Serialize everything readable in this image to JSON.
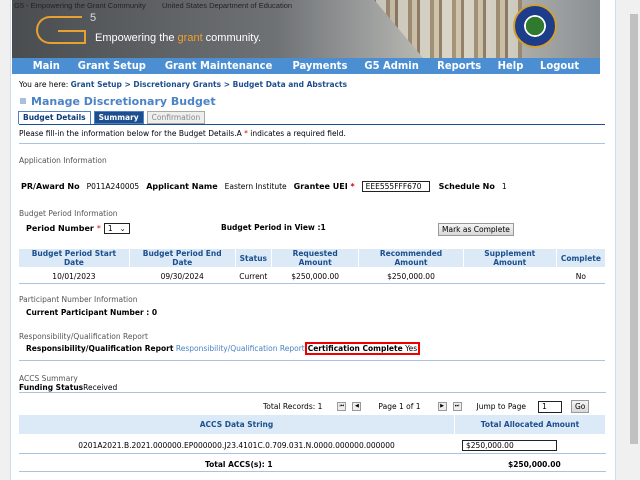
{
  "header": {
    "alt_logo": "G5 - Empowering the Grant Community",
    "alt_dept": "United States Department of Education",
    "tagline_pre": "Empowering the ",
    "tagline_accent": "grant",
    "tagline_post": " community."
  },
  "nav": [
    "Main",
    "Grant Setup",
    "Grant Maintenance",
    "Payments",
    "G5 Admin",
    "Reports",
    "Help",
    "Logout"
  ],
  "breadcrumb": {
    "prefix": "You are here: ",
    "items": [
      "Grant Setup",
      "Discretionary Grants",
      "Budget Data and Abstracts"
    ],
    "sep": " > "
  },
  "page_title": "Manage Discretionary Budget",
  "tabs": [
    "Budget Details",
    "Summary",
    "Confirmation"
  ],
  "instructions": {
    "pre": "Please fill-in the information below for the Budget Details.A ",
    "star": "*",
    "post": " indicates a required field."
  },
  "app_info": {
    "section": "Application Information",
    "award_label": "PR/Award No",
    "award": "P011A240005",
    "applicant_label": "Applicant Name",
    "applicant": "Eastern Institute",
    "uei_label": "Grantee UEI",
    "uei": "EEE555FFF670",
    "schedule_label": "Schedule No",
    "schedule": "1"
  },
  "budget_period": {
    "section": "Budget Period Information",
    "period_label": "Period Number",
    "period_value": "1",
    "in_view": "Budget Period in View :1",
    "mark_complete": "Mark as Complete",
    "columns": [
      "Budget Period Start Date",
      "Budget Period End Date",
      "Status",
      "Requested Amount",
      "Recommended Amount",
      "Supplement Amount",
      "Complete"
    ],
    "rows": [
      [
        "10/01/2023",
        "09/30/2024",
        "Current",
        "$250,000.00",
        "$250,000.00",
        "",
        "No"
      ]
    ]
  },
  "participant": {
    "section": "Participant Number Information",
    "label": "Current Participant Number : 0"
  },
  "responsibility": {
    "section": "Responsibility/Qualification Report",
    "label": "Responsibility/Qualification Report",
    "link": "Responsibility/Qualification Report",
    "cert_label": "Certification Complete",
    "cert_value": "Yes"
  },
  "accs": {
    "section": "ACCS Summary",
    "funding_label": "Funding Status",
    "funding_value": "Received",
    "total_records": "Total Records: 1",
    "page": "Page 1 of 1",
    "jump_label": "Jump to Page",
    "jump_value": "1",
    "go": "Go",
    "columns": [
      "ACCS Data String",
      "Total Allocated Amount"
    ],
    "rows": [
      {
        "string": "0201A2021.B.2021.000000.EP000000.J23.4101C.0.709.031.N.0000.000000.000000",
        "amount": "$250,000.00"
      }
    ],
    "total_label": "Total ACCS(s): 1",
    "total_amount": "$250,000.00"
  }
}
